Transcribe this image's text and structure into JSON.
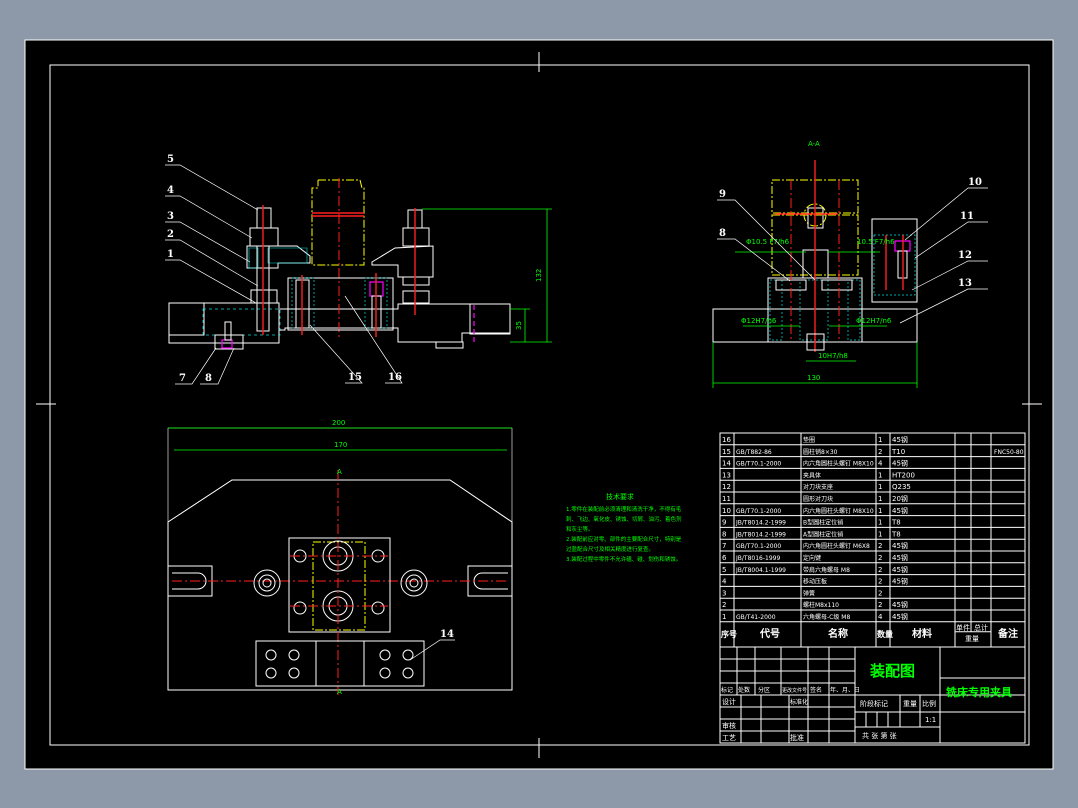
{
  "drawing": {
    "title": "装配图",
    "product_name": "铣床专用夹具",
    "section_label": "A-A",
    "view_marker": "A",
    "colors": {
      "background": "#8d98a9",
      "canvas": "#000000",
      "outline": "#ffffff",
      "center_line": "#ff2020",
      "dimension": "#00ff00",
      "hatch": "#00e0e0",
      "phantom": "#ffff00"
    }
  },
  "front_view": {
    "callouts": [
      "5",
      "4",
      "3",
      "2",
      "1",
      "7",
      "8",
      "15",
      "16"
    ],
    "dims": {
      "height": "132",
      "base_height": "35"
    }
  },
  "section_view": {
    "callouts": [
      "9",
      "8",
      "10",
      "11",
      "12",
      "13"
    ],
    "dims": {
      "fit_left": "Φ10.5 F7/h6",
      "fit_right": "10.5 F7/h6",
      "bore_left": "Φ12H7/n6",
      "bore_right": "Φ12H7/n6",
      "key": "10H7/h8",
      "width": "130"
    }
  },
  "top_view": {
    "callouts": [
      "14"
    ],
    "dims": {
      "overall": "200",
      "inner": "170"
    }
  },
  "tech_notes": {
    "title": "技术要求",
    "lines": [
      "1.零件在装配前必须清理和清洗干净，不得有毛",
      "刺、飞边、氧化皮、锈蚀、切屑、油污、着色剂",
      "和灰尘等。",
      "2.装配前应对零、部件的主要配合尺寸，特别是",
      "过盈配合尺寸及相关精度进行复查。",
      "3.装配过程中零件不允许磕、碰、划伤和锈蚀。"
    ]
  },
  "bom": {
    "headers": {
      "no": "序号",
      "code": "代号",
      "name": "名称",
      "qty": "数量",
      "material": "材料",
      "unit": "单件",
      "total": "总计",
      "weight": "重量",
      "remark": "备注"
    },
    "rows": [
      {
        "no": "16",
        "code": "",
        "name": "垫圈",
        "qty": "1",
        "material": "45钢",
        "remark": ""
      },
      {
        "no": "15",
        "code": "GB/T882-86",
        "name": "圆柱销8×30",
        "qty": "2",
        "material": "T10",
        "remark": "FNC50-80"
      },
      {
        "no": "14",
        "code": "GB/T70.1-2000",
        "name": "内六角圆柱头螺钉 M8X10",
        "qty": "4",
        "material": "45钢",
        "remark": ""
      },
      {
        "no": "13",
        "code": "",
        "name": "夹具体",
        "qty": "1",
        "material": "HT200",
        "remark": ""
      },
      {
        "no": "12",
        "code": "",
        "name": "对刀块支座",
        "qty": "1",
        "material": "Q235",
        "remark": ""
      },
      {
        "no": "11",
        "code": "",
        "name": "圆形对刀块",
        "qty": "1",
        "material": "20钢",
        "remark": ""
      },
      {
        "no": "10",
        "code": "GB/T70.1-2000",
        "name": "内六角圆柱头螺钉 M8X10",
        "qty": "1",
        "material": "45钢",
        "remark": ""
      },
      {
        "no": "9",
        "code": "JB/T8014.2-1999",
        "name": "B型圆柱定位销",
        "qty": "1",
        "material": "T8",
        "remark": ""
      },
      {
        "no": "8",
        "code": "JB/T8014.2-1999",
        "name": "A型圆柱定位销",
        "qty": "1",
        "material": "T8",
        "remark": ""
      },
      {
        "no": "7",
        "code": "GB/T70.1-2000",
        "name": "内六角圆柱头螺钉 M6X8",
        "qty": "2",
        "material": "45钢",
        "remark": ""
      },
      {
        "no": "6",
        "code": "JB/T8016-1999",
        "name": "定向键",
        "qty": "2",
        "material": "45钢",
        "remark": ""
      },
      {
        "no": "5",
        "code": "JB/T8004.1-1999",
        "name": "带肩六角螺母 M8",
        "qty": "2",
        "material": "45钢",
        "remark": ""
      },
      {
        "no": "4",
        "code": "",
        "name": "移动压板",
        "qty": "2",
        "material": "45钢",
        "remark": ""
      },
      {
        "no": "3",
        "code": "",
        "name": "弹簧",
        "qty": "2",
        "material": "",
        "remark": ""
      },
      {
        "no": "2",
        "code": "",
        "name": "螺柱M8x110",
        "qty": "2",
        "material": "45钢",
        "remark": ""
      },
      {
        "no": "1",
        "code": "GB/T41-2000",
        "name": "六角螺母-C级 M8",
        "qty": "4",
        "material": "45钢",
        "remark": ""
      }
    ]
  },
  "title_block": {
    "revision_headers": [
      "标记",
      "处数",
      "分区",
      "更改文件号",
      "签名",
      "年、月、日"
    ],
    "design": "设计",
    "standardization": "标准化",
    "review": "审核",
    "process": "工艺",
    "approve": "批准",
    "stage_mark": "阶段标记",
    "weight": "重量",
    "scale_label": "比例",
    "scale": "1:1",
    "sheets": "共    张  第    张"
  }
}
